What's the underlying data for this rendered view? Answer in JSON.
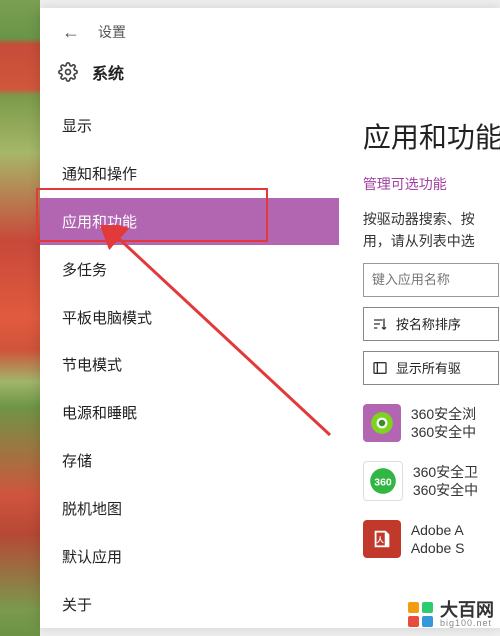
{
  "titlebar": {
    "label": "设置"
  },
  "section": {
    "title": "系统"
  },
  "nav": {
    "items": [
      {
        "label": "显示"
      },
      {
        "label": "通知和操作"
      },
      {
        "label": "应用和功能"
      },
      {
        "label": "多任务"
      },
      {
        "label": "平板电脑模式"
      },
      {
        "label": "节电模式"
      },
      {
        "label": "电源和睡眠"
      },
      {
        "label": "存储"
      },
      {
        "label": "脱机地图"
      },
      {
        "label": "默认应用"
      },
      {
        "label": "关于"
      }
    ],
    "selected_index": 2
  },
  "main": {
    "title": "应用和功能",
    "manage_link": "管理可选功能",
    "desc_line1": "按驱动器搜索、按",
    "desc_line2": "用，请从列表中选",
    "search_placeholder": "键入应用名称",
    "sort_label": "按名称排序",
    "filter_label": "显示所有驱",
    "apps": [
      {
        "line1": "360安全浏",
        "line2": "360安全中",
        "color": "#b266b2",
        "fg": "#7ed321",
        "icon": "browser"
      },
      {
        "line1": "360安全卫",
        "line2": "360安全中",
        "color": "#32b643",
        "fg": "#fff",
        "icon": "shield"
      },
      {
        "line1": "Adobe A",
        "line2": "Adobe S",
        "color": "#c0392b",
        "fg": "#fff",
        "icon": "pdf"
      }
    ]
  },
  "watermark": {
    "name": "大百网",
    "domain": "big100.net"
  }
}
